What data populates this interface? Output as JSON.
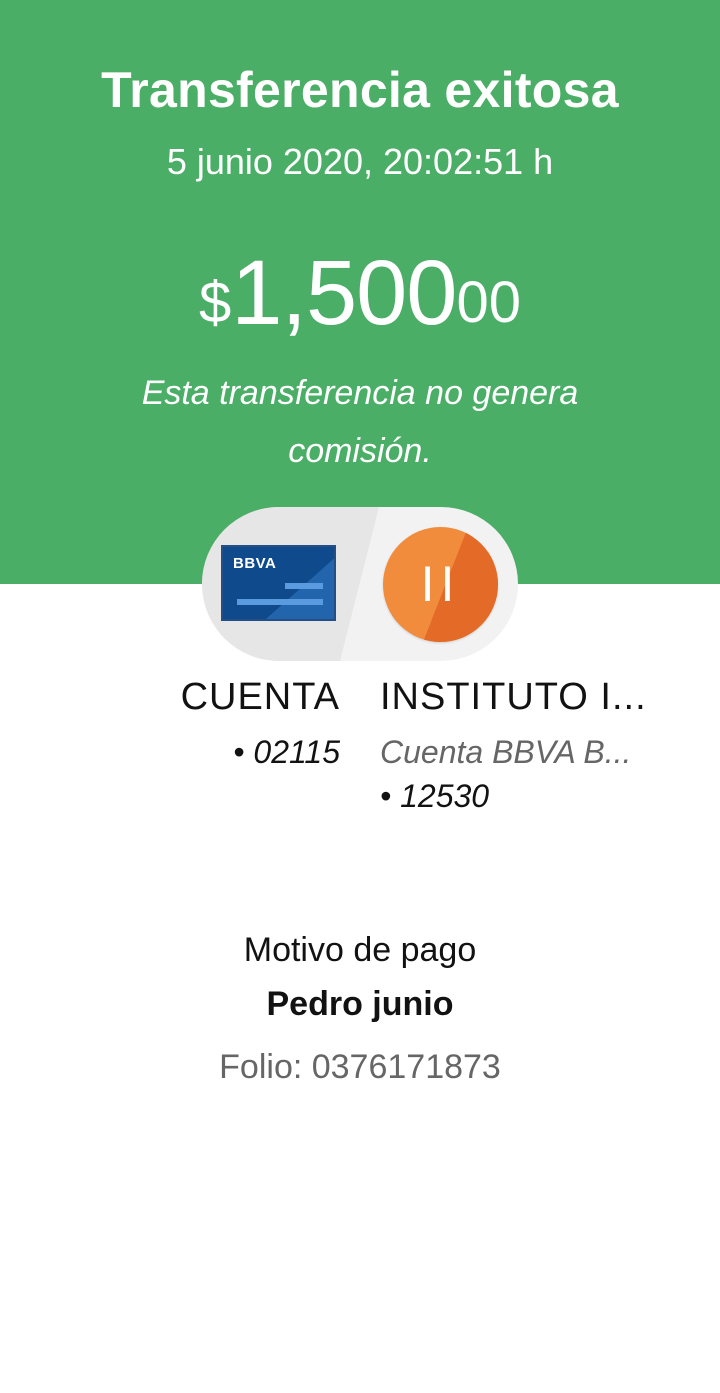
{
  "header": {
    "title": "Transferencia exitosa",
    "datetime": "5 junio 2020, 20:02:51 h",
    "amount": {
      "currency": "$",
      "integer": "1,500",
      "cents": "00"
    },
    "note": "Esta transferencia no genera comisión.",
    "background_color": "#4BAE67"
  },
  "transfer": {
    "origin": {
      "card_logo": "BBVA",
      "card_icon": "bank-card-icon",
      "name": "CUENTA",
      "account": "• 02115"
    },
    "destination": {
      "initials": "II",
      "avatar_color": "#F28C3D",
      "name": "INSTITUTO I...",
      "bank": "Cuenta BBVA B...",
      "account": "• 12530"
    }
  },
  "details": {
    "reason_label": "Motivo de pago",
    "reason_value": "Pedro junio",
    "folio": "Folio: 0376171873"
  }
}
